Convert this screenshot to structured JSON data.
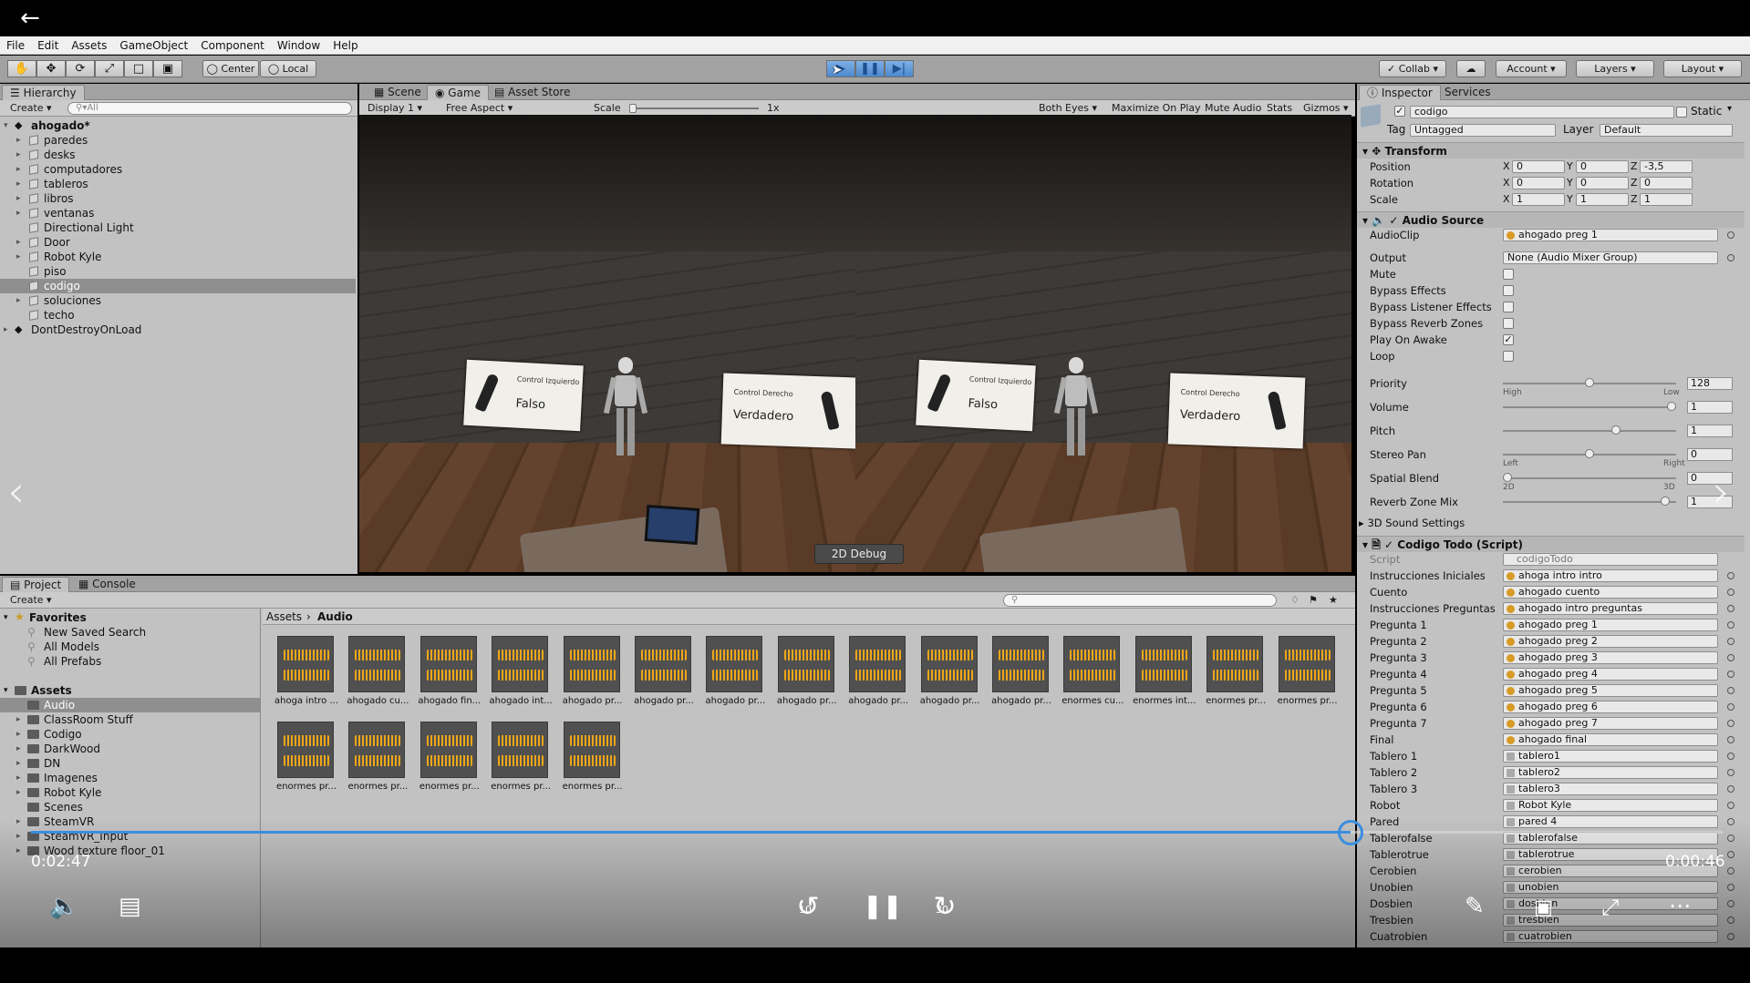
{
  "menu": [
    "File",
    "Edit",
    "Assets",
    "GameObject",
    "Component",
    "Window",
    "Help"
  ],
  "toolbar": {
    "pivot": "Center",
    "space": "Local",
    "collab": "Collab",
    "account": "Account",
    "layers": "Layers",
    "layout": "Layout"
  },
  "hierarchy": {
    "tab": "Hierarchy",
    "create": "Create",
    "search_placeholder": "All",
    "scene": "ahogado*",
    "items": [
      "paredes",
      "desks",
      "computadores",
      "tableros",
      "libros",
      "ventanas",
      "Directional Light",
      "Door",
      "Robot Kyle",
      "piso",
      "codigo",
      "soluciones",
      "techo"
    ],
    "selected": "codigo",
    "ddol": "DontDestroyOnLoad"
  },
  "game": {
    "tabs": [
      "Scene",
      "Game",
      "Asset Store"
    ],
    "active_tab": "Game",
    "display": "Display 1",
    "aspect": "Free Aspect",
    "scale_label": "Scale",
    "scale_value": "1x",
    "controls": [
      "Both Eyes",
      "Maximize On Play",
      "Mute Audio",
      "Stats",
      "Gizmos"
    ],
    "left_card": {
      "title": "Control Izquierdo",
      "value": "Falso"
    },
    "right_card": {
      "title": "Control Derecho",
      "value": "Verdadero"
    },
    "debug_button": "2D Debug"
  },
  "inspector": {
    "tabs": [
      "Inspector",
      "Services"
    ],
    "object_name": "codigo",
    "static_label": "Static",
    "tag_label": "Tag",
    "tag": "Untagged",
    "layer_label": "Layer",
    "layer": "Default",
    "transform": {
      "title": "Transform",
      "position": {
        "label": "Position",
        "x": "0",
        "y": "0",
        "z": "-3,5"
      },
      "rotation": {
        "label": "Rotation",
        "x": "0",
        "y": "0",
        "z": "0"
      },
      "scale": {
        "label": "Scale",
        "x": "1",
        "y": "1",
        "z": "1"
      }
    },
    "audio_source": {
      "title": "Audio Source",
      "audioclip_label": "AudioClip",
      "audioclip": "ahogado preg 1",
      "output_label": "Output",
      "output": "None (Audio Mixer Group)",
      "toggles": [
        {
          "label": "Mute",
          "checked": false
        },
        {
          "label": "Bypass Effects",
          "checked": false
        },
        {
          "label": "Bypass Listener Effects",
          "checked": false
        },
        {
          "label": "Bypass Reverb Zones",
          "checked": false
        },
        {
          "label": "Play On Awake",
          "checked": true
        },
        {
          "label": "Loop",
          "checked": false
        }
      ],
      "sliders": [
        {
          "label": "Priority",
          "value": "128",
          "pos": 0.5,
          "min_label": "High",
          "max_label": "Low"
        },
        {
          "label": "Volume",
          "value": "1",
          "pos": 1.0,
          "min_label": "",
          "max_label": ""
        },
        {
          "label": "Pitch",
          "value": "1",
          "pos": 0.66,
          "min_label": "",
          "max_label": ""
        },
        {
          "label": "Stereo Pan",
          "value": "0",
          "pos": 0.5,
          "min_label": "Left",
          "max_label": "Right"
        },
        {
          "label": "Spatial Blend",
          "value": "0",
          "pos": 0.0,
          "min_label": "2D",
          "max_label": "3D"
        },
        {
          "label": "Reverb Zone Mix",
          "value": "1",
          "pos": 0.96,
          "min_label": "",
          "max_label": ""
        }
      ],
      "sound3d": "3D Sound Settings"
    },
    "script": {
      "title": "Codigo Todo (Script)",
      "script_label": "Script",
      "script_value": "codigoTodo",
      "fields": [
        {
          "label": "Instrucciones Iniciales",
          "value": "ahoga intro intro",
          "kind": "audio"
        },
        {
          "label": "Cuento",
          "value": "ahogado cuento",
          "kind": "audio"
        },
        {
          "label": "Instrucciones Preguntas",
          "value": "ahogado intro preguntas",
          "kind": "audio"
        },
        {
          "label": "Pregunta 1",
          "value": "ahogado preg 1",
          "kind": "audio"
        },
        {
          "label": "Pregunta 2",
          "value": "ahogado preg 2",
          "kind": "audio"
        },
        {
          "label": "Pregunta 3",
          "value": "ahogado preg 3",
          "kind": "audio"
        },
        {
          "label": "Pregunta 4",
          "value": "ahogado preg 4",
          "kind": "audio"
        },
        {
          "label": "Pregunta 5",
          "value": "ahogado preg 5",
          "kind": "audio"
        },
        {
          "label": "Pregunta 6",
          "value": "ahogado preg 6",
          "kind": "audio"
        },
        {
          "label": "Pregunta 7",
          "value": "ahogado preg 7",
          "kind": "audio"
        },
        {
          "label": "Final",
          "value": "ahogado final",
          "kind": "audio"
        },
        {
          "label": "Tablero 1",
          "value": "tablero1",
          "kind": "go"
        },
        {
          "label": "Tablero 2",
          "value": "tablero2",
          "kind": "go"
        },
        {
          "label": "Tablero 3",
          "value": "tablero3",
          "kind": "go"
        },
        {
          "label": "Robot",
          "value": "Robot Kyle",
          "kind": "go"
        },
        {
          "label": "Pared",
          "value": "pared 4",
          "kind": "go"
        },
        {
          "label": "Tablerofalse",
          "value": "tablerofalse",
          "kind": "go"
        },
        {
          "label": "Tablerotrue",
          "value": "tablerotrue",
          "kind": "go"
        },
        {
          "label": "Cerobien",
          "value": "cerobien",
          "kind": "go"
        },
        {
          "label": "Unobien",
          "value": "unobien",
          "kind": "go"
        },
        {
          "label": "Dosbien",
          "value": "dosbien",
          "kind": "go"
        },
        {
          "label": "Tresbien",
          "value": "tresbien",
          "kind": "go"
        },
        {
          "label": "Cuatrobien",
          "value": "cuatrobien",
          "kind": "go"
        }
      ]
    }
  },
  "project": {
    "tabs": [
      "Project",
      "Console"
    ],
    "create": "Create",
    "favorites_label": "Favorites",
    "favorites": [
      "New Saved Search",
      "All Models",
      "All Prefabs"
    ],
    "assets_label": "Assets",
    "folders": [
      "Audio",
      "ClassRoom Stuff",
      "Codigo",
      "DarkWood",
      "DN",
      "Imagenes",
      "Robot Kyle",
      "Scenes",
      "SteamVR",
      "SteamVR_Input",
      "Wood texture floor_01"
    ],
    "selected_folder": "Audio",
    "breadcrumb": [
      "Assets",
      "Audio"
    ],
    "files": [
      "ahoga intro ...",
      "ahogado cu...",
      "ahogado fin...",
      "ahogado int...",
      "ahogado pr...",
      "ahogado pr...",
      "ahogado pr...",
      "ahogado pr...",
      "ahogado pr...",
      "ahogado pr...",
      "ahogado pr...",
      "enormes cu...",
      "enormes int...",
      "enormes pr...",
      "enormes pr...",
      "enormes pr...",
      "enormes pr...",
      "enormes pr...",
      "enormes pr...",
      "enormes pr..."
    ]
  },
  "player": {
    "elapsed": "0:02:47",
    "remaining": "0:00:46",
    "progress": 0.78,
    "skip_back": "10",
    "skip_forward": "30"
  }
}
